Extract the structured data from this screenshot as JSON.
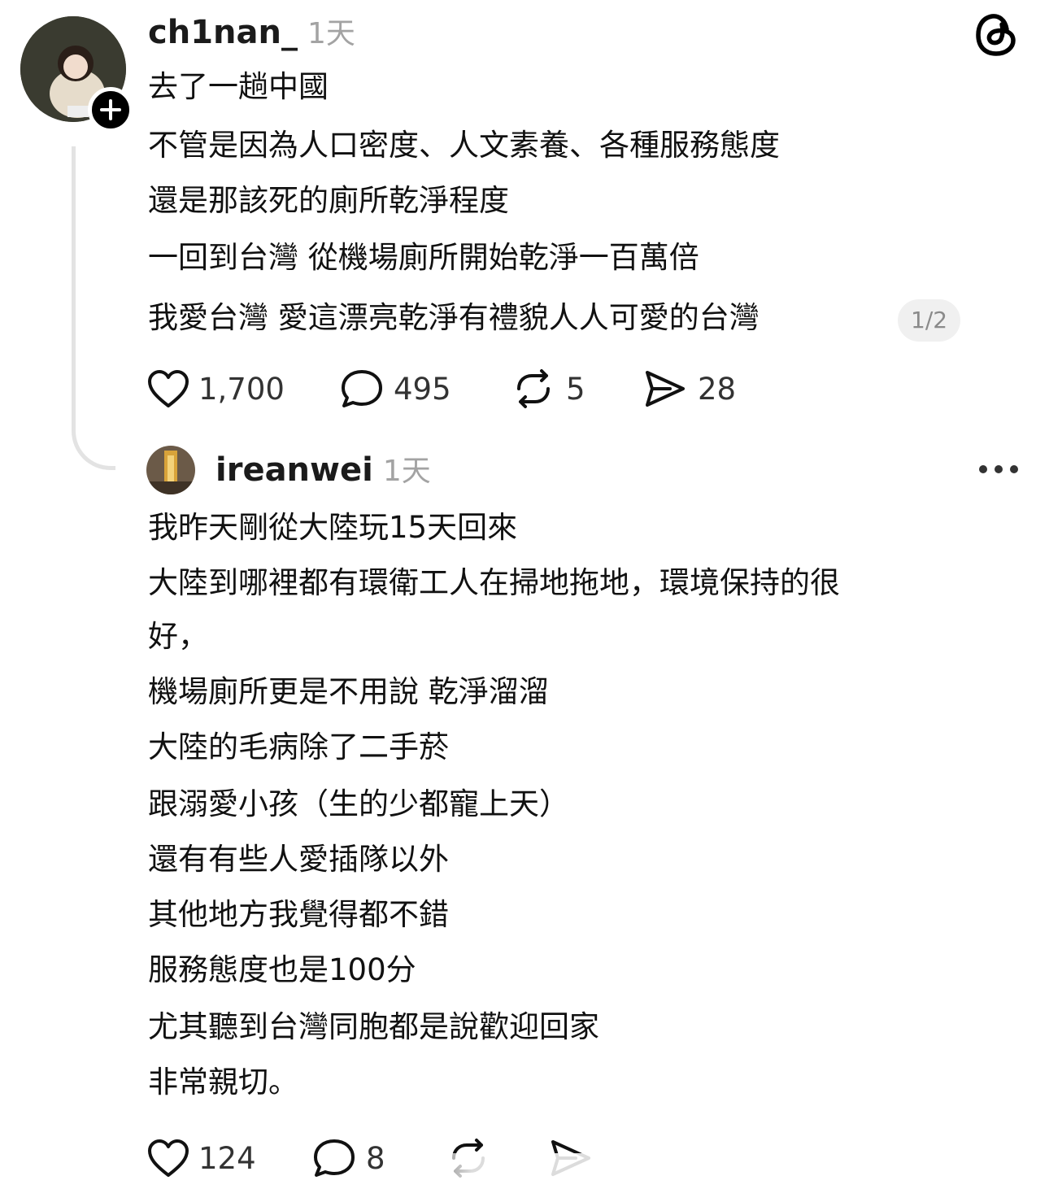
{
  "post": {
    "username": "ch1nan_",
    "time": "1天",
    "lines": [
      "去了一趟中國",
      "不管是因為人口密度、人文素養、各種服務態度",
      "還是那該死的廁所乾淨程度",
      "一回到台灣 從機場廁所開始乾淨一百萬倍",
      "我愛台灣 愛這漂亮乾淨有禮貌人人可愛的台灣"
    ],
    "page_indicator": "1/2",
    "likes": "1,700",
    "comments": "495",
    "reposts": "5",
    "shares": "28"
  },
  "reply": {
    "username": "ireanwei",
    "time": "1天",
    "lines": [
      "我昨天剛從大陸玩15天回來",
      "大陸到哪裡都有環衛工人在掃地拖地，環境保持的很",
      "好，",
      "機場廁所更是不用說 乾淨溜溜",
      "大陸的毛病除了二手菸",
      "跟溺愛小孩（生的少都寵上天）",
      "還有有些人愛插隊以外",
      "其他地方我覺得都不錯",
      "服務態度也是100分",
      "尤其聽到台灣同胞都是說歡迎回家",
      "非常親切。"
    ],
    "likes": "124",
    "comments": "8"
  },
  "icons": {
    "app": "threads-logo-icon",
    "follow": "plus-icon",
    "like": "heart-icon",
    "comment": "comment-bubble-icon",
    "repost": "repost-icon",
    "share": "send-icon",
    "more": "more-dots-icon"
  }
}
